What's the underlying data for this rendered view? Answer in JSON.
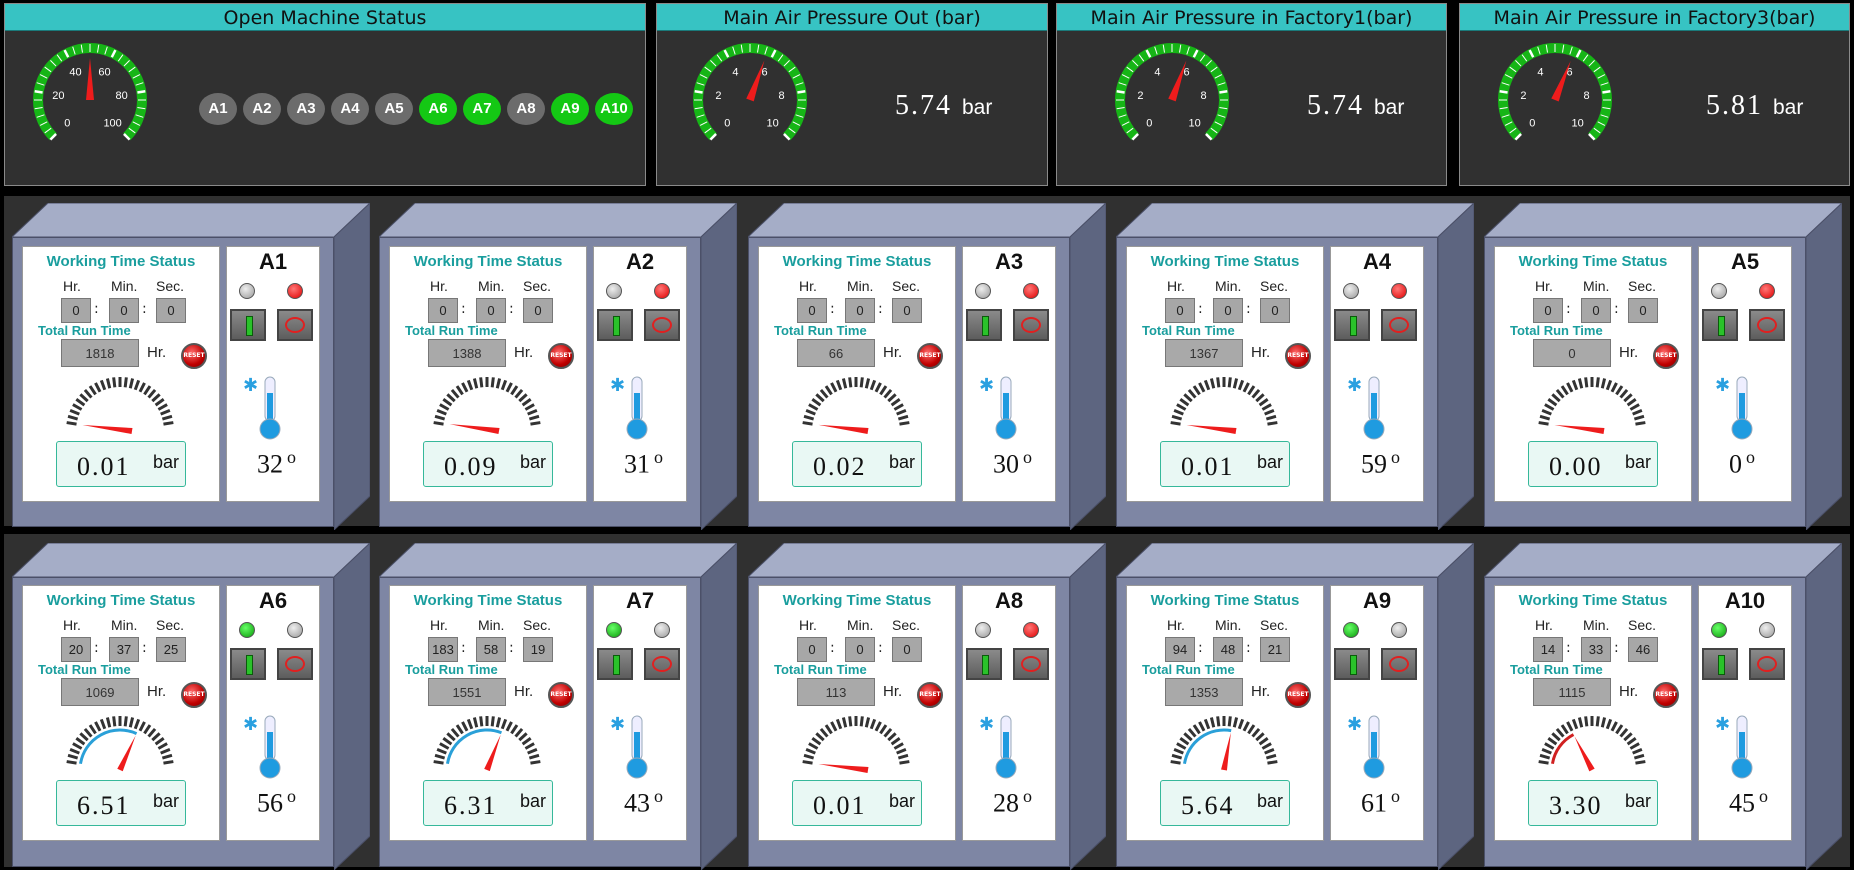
{
  "colors": {
    "accent": "#37c3c3",
    "machine_on": "#14c814",
    "machine_off": "#6c6c6c",
    "panel_bg": "#303030",
    "cabinet": "#7e86a4"
  },
  "top": {
    "open_machine": {
      "title": "Open Machine Status",
      "gauge_ticks": [
        "0",
        "20",
        "40",
        "60",
        "80",
        "100"
      ],
      "gauge_value": 50,
      "machines": [
        {
          "label": "A1",
          "on": false
        },
        {
          "label": "A2",
          "on": false
        },
        {
          "label": "A3",
          "on": false
        },
        {
          "label": "A4",
          "on": false
        },
        {
          "label": "A5",
          "on": false
        },
        {
          "label": "A6",
          "on": true
        },
        {
          "label": "A7",
          "on": true
        },
        {
          "label": "A8",
          "on": false
        },
        {
          "label": "A9",
          "on": true
        },
        {
          "label": "A10",
          "on": true
        }
      ]
    },
    "pressure_panels": [
      {
        "title": "Main Air Pressure Out (bar)",
        "value": "5.74",
        "unit": "bar",
        "ticks": [
          "0",
          "2",
          "4",
          "6",
          "8",
          "10"
        ]
      },
      {
        "title": "Main Air Pressure in Factory1(bar)",
        "value": "5.74",
        "unit": "bar",
        "ticks": [
          "0",
          "2",
          "4",
          "6",
          "8",
          "10"
        ]
      },
      {
        "title": "Main Air Pressure in Factory3(bar)",
        "value": "5.81",
        "unit": "bar",
        "ticks": [
          "0",
          "2",
          "4",
          "6",
          "8",
          "10"
        ]
      }
    ]
  },
  "labels": {
    "wts_title": "Working Time Status",
    "hr": "Hr.",
    "min": "Min.",
    "sec": "Sec.",
    "total_run": "Total Run Time",
    "hr_unit": "Hr.",
    "bar": "bar",
    "reset": "RESET"
  },
  "machines": [
    {
      "name": "A1",
      "h": "0",
      "m": "0",
      "s": "0",
      "run": "1818",
      "pressure": "0.01",
      "temp": "32",
      "running": false
    },
    {
      "name": "A2",
      "h": "0",
      "m": "0",
      "s": "0",
      "run": "1388",
      "pressure": "0.09",
      "temp": "31",
      "running": false
    },
    {
      "name": "A3",
      "h": "0",
      "m": "0",
      "s": "0",
      "run": "66",
      "pressure": "0.02",
      "temp": "30",
      "running": false
    },
    {
      "name": "A4",
      "h": "0",
      "m": "0",
      "s": "0",
      "run": "1367",
      "pressure": "0.01",
      "temp": "59",
      "running": false
    },
    {
      "name": "A5",
      "h": "0",
      "m": "0",
      "s": "0",
      "run": "0",
      "pressure": "0.00",
      "temp": "0",
      "running": false
    },
    {
      "name": "A6",
      "h": "20",
      "m": "37",
      "s": "25",
      "run": "1069",
      "pressure": "6.51",
      "temp": "56",
      "running": true
    },
    {
      "name": "A7",
      "h": "183",
      "m": "58",
      "s": "19",
      "run": "1551",
      "pressure": "6.31",
      "temp": "43",
      "running": true
    },
    {
      "name": "A8",
      "h": "0",
      "m": "0",
      "s": "0",
      "run": "113",
      "pressure": "0.01",
      "temp": "28",
      "running": false
    },
    {
      "name": "A9",
      "h": "94",
      "m": "48",
      "s": "21",
      "run": "1353",
      "pressure": "5.64",
      "temp": "61",
      "running": true
    },
    {
      "name": "A10",
      "h": "14",
      "m": "33",
      "s": "46",
      "run": "1115",
      "pressure": "3.30",
      "temp": "45",
      "running": true
    }
  ]
}
